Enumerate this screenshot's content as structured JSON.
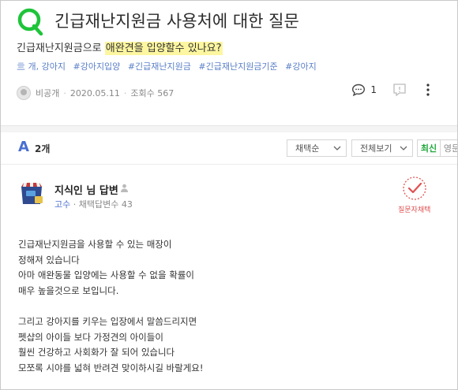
{
  "question": {
    "title": "긴급재난지원금 사용처에 대한 질문",
    "subtitle_prefix": "긴급재난지원금으로 ",
    "subtitle_highlight": "애완견을 입양할수 있나요?",
    "tags": [
      "亖 개, 강아지",
      "#강아지입양",
      "#긴급재난지원금",
      "#긴급재난지원금기준",
      "#강아지"
    ],
    "author": "비공개",
    "date": "2020.05.11",
    "views": "조회수 567",
    "comment_count": "1"
  },
  "answers_bar": {
    "letter": "A",
    "count": "2개",
    "filter1": "채택순",
    "filter2": "전체보기",
    "sort_latest": "최신",
    "sort_accepted": "영문"
  },
  "answer": {
    "name": "지식인 님 답변",
    "rank": "고수",
    "adopted": "채택답변수 43",
    "stamp": "질문자채택",
    "lines": [
      "긴급재난지원금을 사용할 수 있는 매장이",
      "정해져 있습니다",
      "아마 애완동물 입양에는 사용할 수 없을 확률이",
      "매우 높을것으로 보입니다.",
      "",
      "그리고 강아지를 키우는 입장에서 말씀드리지면",
      "펫샵의 아이들 보다 가정견의 아이들이",
      "훨씬 건강하고 사회화가 잘 되어 있습니다",
      "모쪼록 시야를 넓혀 반려견 맞이하시길 바랄게요!"
    ]
  },
  "colors": {
    "brand_green": "#1ea83a",
    "tag_blue": "#5a7fc7",
    "highlight": "#fdf6a0"
  }
}
